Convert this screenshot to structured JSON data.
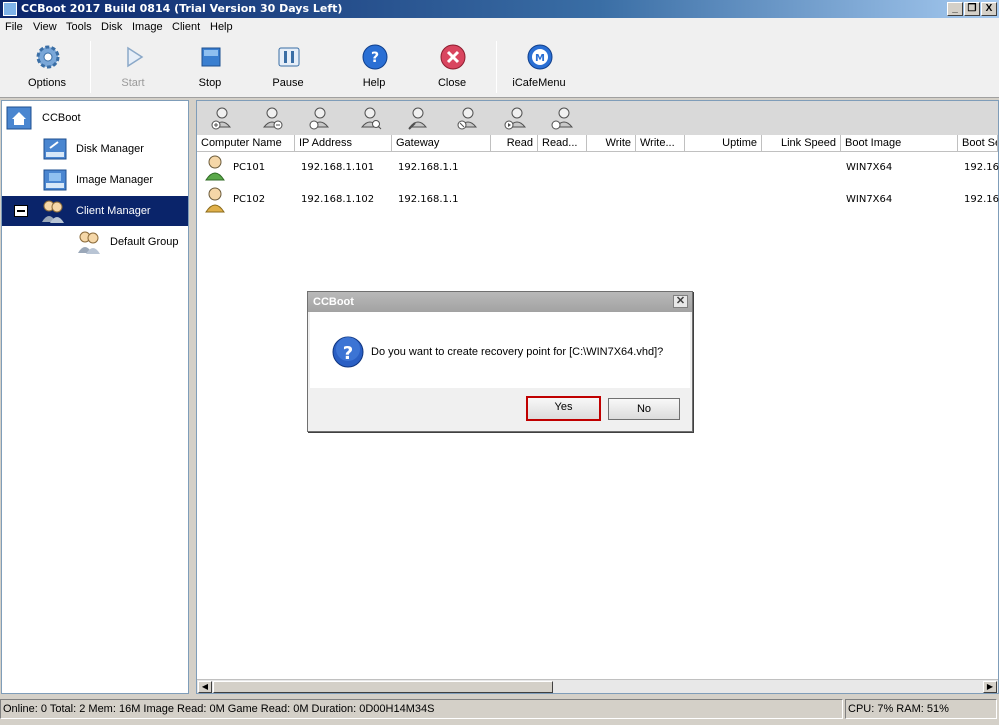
{
  "window": {
    "title": "CCBoot 2017 Build 0814 (Trial Version 30 Days Left)",
    "controls": {
      "minimize": "_",
      "restore": "❐",
      "close": "X"
    }
  },
  "menu": [
    "File",
    "View",
    "Tools",
    "Disk",
    "Image",
    "Client",
    "Help"
  ],
  "toolbar": {
    "options": "Options",
    "start": "Start",
    "stop": "Stop",
    "pause": "Pause",
    "help": "Help",
    "close": "Close",
    "icafemenu": "iCafeMenu"
  },
  "nav": {
    "root": "CCBoot",
    "disk_manager": "Disk Manager",
    "image_manager": "Image Manager",
    "client_manager": "Client Manager",
    "default_group": "Default Group"
  },
  "table": {
    "columns": [
      "Computer Name",
      "IP Address",
      "Gateway",
      "Read",
      "Read...",
      "Write",
      "Write...",
      "Uptime",
      "Link Speed",
      "Boot Image",
      "Boot Se"
    ],
    "rows": [
      {
        "name": "PC101",
        "ip": "192.168.1.101",
        "gateway": "192.168.1.1",
        "boot_image": "WIN7X64",
        "boot_server": "192.16"
      },
      {
        "name": "PC102",
        "ip": "192.168.1.102",
        "gateway": "192.168.1.1",
        "boot_image": "WIN7X64",
        "boot_server": "192.16"
      }
    ]
  },
  "status": {
    "left": "Online: 0 Total: 2 Mem: 16M Image Read: 0M Game Read: 0M Duration: 0D00H14M34S",
    "right": "CPU: 7% RAM: 51%"
  },
  "dialog": {
    "title": "CCBoot",
    "close": "✕",
    "message": "Do you want to create recovery point for [C:\\WIN7X64.vhd]?",
    "yes": "Yes",
    "no": "No"
  },
  "colors": {
    "selection": "#0a246a",
    "default_button_border": "#c00000",
    "help_blue": "#2a6fd4",
    "close_red": "#d9455f"
  }
}
